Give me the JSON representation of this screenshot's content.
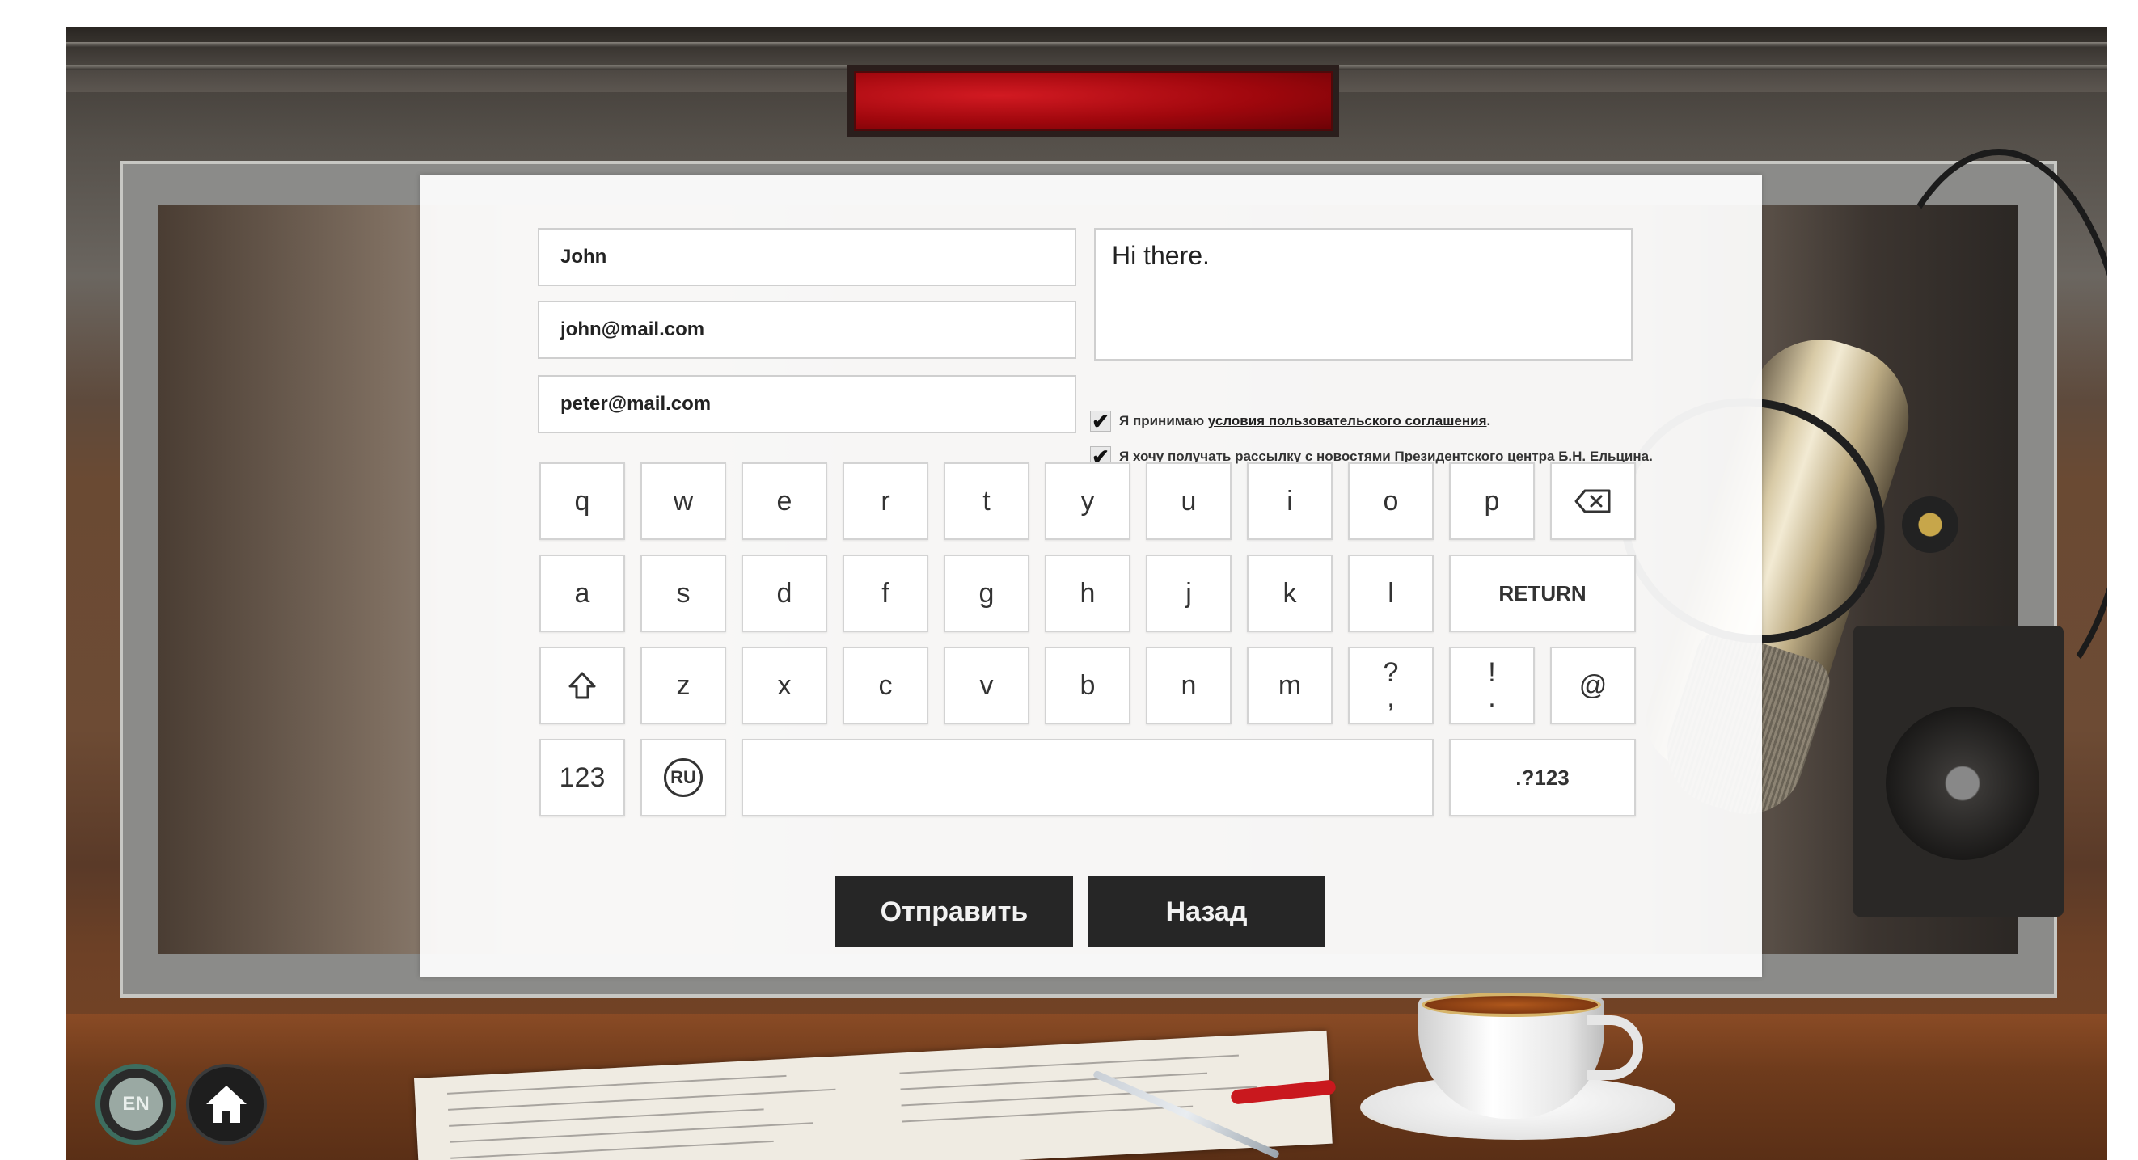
{
  "form": {
    "name_value": "John",
    "email_value": "john@mail.com",
    "recipient_value": "peter@mail.com",
    "message_value": "Hi there.",
    "agreement_terms_prefix": "Я принимаю",
    "agreement_terms_link": "условия пользовательского соглашения",
    "agreement_terms_suffix": ".",
    "agreement_terms_checked": true,
    "agreement_newsletter_text": "Я хочу получать рассылку с новостями Президентского центра Б.Н. Ельцина.",
    "agreement_newsletter_checked": true,
    "checkmark": "✔"
  },
  "keyboard": {
    "row1": [
      "q",
      "w",
      "e",
      "r",
      "t",
      "y",
      "u",
      "i",
      "o",
      "p"
    ],
    "row2": [
      "a",
      "s",
      "d",
      "f",
      "g",
      "h",
      "j",
      "k",
      "l"
    ],
    "row3": [
      "z",
      "x",
      "c",
      "v",
      "b",
      "n",
      "m"
    ],
    "return_label": "RETURN",
    "numeric_label": "123",
    "language_label": "RU",
    "symbols_label": ".?123",
    "question_top": "?",
    "question_bottom": ",",
    "exclaim_top": "!",
    "exclaim_bottom": ".",
    "at_label": "@",
    "backspace_icon": "backspace-icon",
    "shift_icon": "shift-icon"
  },
  "actions": {
    "send_label": "Отправить",
    "back_label": "Назад"
  },
  "corner": {
    "language_label": "EN",
    "home_icon": "home-icon"
  },
  "colors": {
    "button_dark": "#262626",
    "on_air_red": "#c0101a",
    "language_ring": "#3d6d5f"
  }
}
